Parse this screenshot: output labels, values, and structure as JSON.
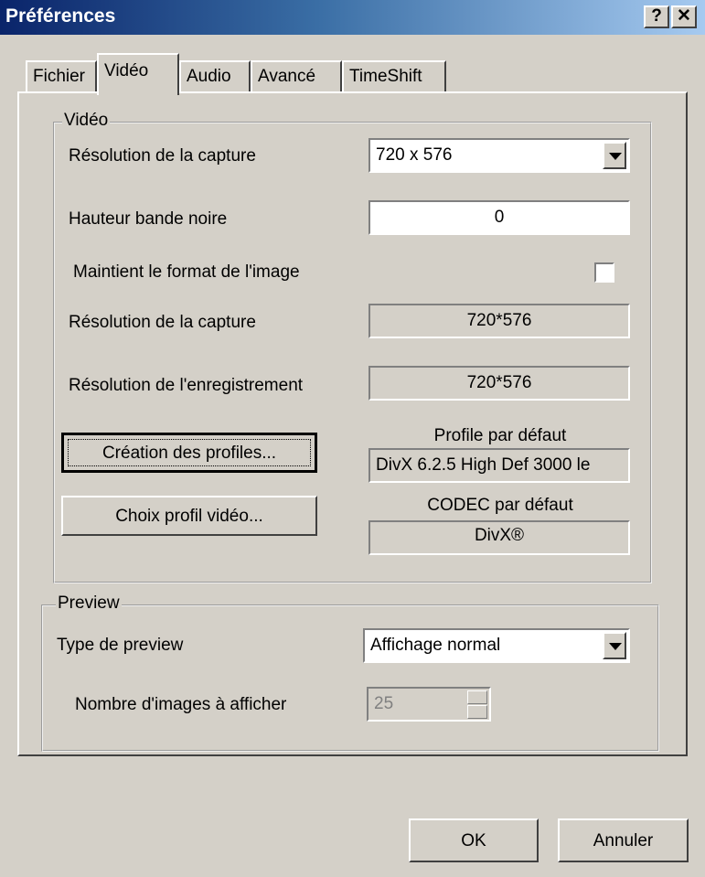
{
  "window": {
    "title": "Préférences",
    "help_label": "?",
    "close_label": "✕"
  },
  "tabs": [
    {
      "label": "Fichier"
    },
    {
      "label": "Vidéo"
    },
    {
      "label": "Audio"
    },
    {
      "label": "Avancé"
    },
    {
      "label": "TimeShift"
    }
  ],
  "video_group": {
    "title": "Vidéo",
    "capture_resolution_label": "Résolution de la capture",
    "capture_resolution_value": "720 x 576",
    "black_band_label": "Hauteur bande noire",
    "black_band_value": "0",
    "keep_aspect_label": "Maintient le format de l'image",
    "keep_aspect_checked": false,
    "capture_resolution_ro_label": "Résolution de la capture",
    "capture_resolution_ro_value": "720*576",
    "record_resolution_label": "Résolution de l'enregistrement",
    "record_resolution_value": "720*576",
    "create_profiles_label": "Création des profiles...",
    "default_profile_label": "Profile par défaut",
    "default_profile_value": "DivX 6.2.5 High Def 3000 le",
    "choose_profile_label": "Choix profil vidéo...",
    "default_codec_label": "CODEC par défaut",
    "default_codec_value": "DivX®"
  },
  "preview_group": {
    "title": "Preview",
    "preview_type_label": "Type de preview",
    "preview_type_value": "Affichage normal",
    "frames_label": "Nombre d'images à afficher",
    "frames_value": "25"
  },
  "footer": {
    "ok_label": "OK",
    "cancel_label": "Annuler"
  }
}
